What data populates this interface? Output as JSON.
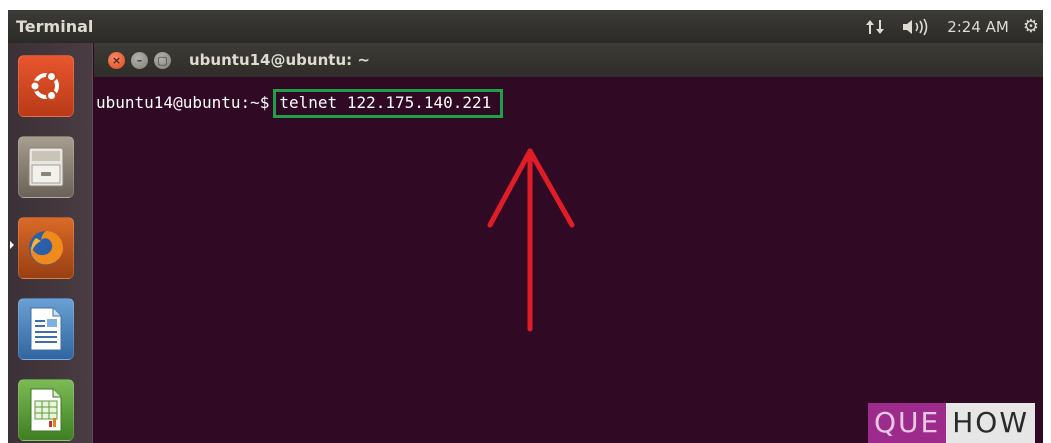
{
  "panel": {
    "app_name": "Terminal",
    "clock": "2:24 AM",
    "network_icon": "network-updown-icon",
    "volume_icon": "volume-icon",
    "settings_icon": "gear-icon"
  },
  "launcher": {
    "items": [
      {
        "name": "ubuntu-dash",
        "icon": "ubuntu-logo-icon"
      },
      {
        "name": "files",
        "icon": "file-cabinet-icon"
      },
      {
        "name": "firefox",
        "icon": "firefox-icon"
      },
      {
        "name": "libreoffice-writer",
        "icon": "document-writer-icon"
      },
      {
        "name": "libreoffice-calc",
        "icon": "spreadsheet-icon"
      }
    ]
  },
  "terminal": {
    "window_title": "ubuntu14@ubuntu: ~",
    "prompt": "ubuntu14@ubuntu:~$",
    "command": "telnet 122.175.140.221"
  },
  "annotations": {
    "highlight_color": "#1fa046",
    "arrow_color": "#e01d27"
  },
  "watermark": {
    "part1": "QUE",
    "part2": "HOW"
  }
}
